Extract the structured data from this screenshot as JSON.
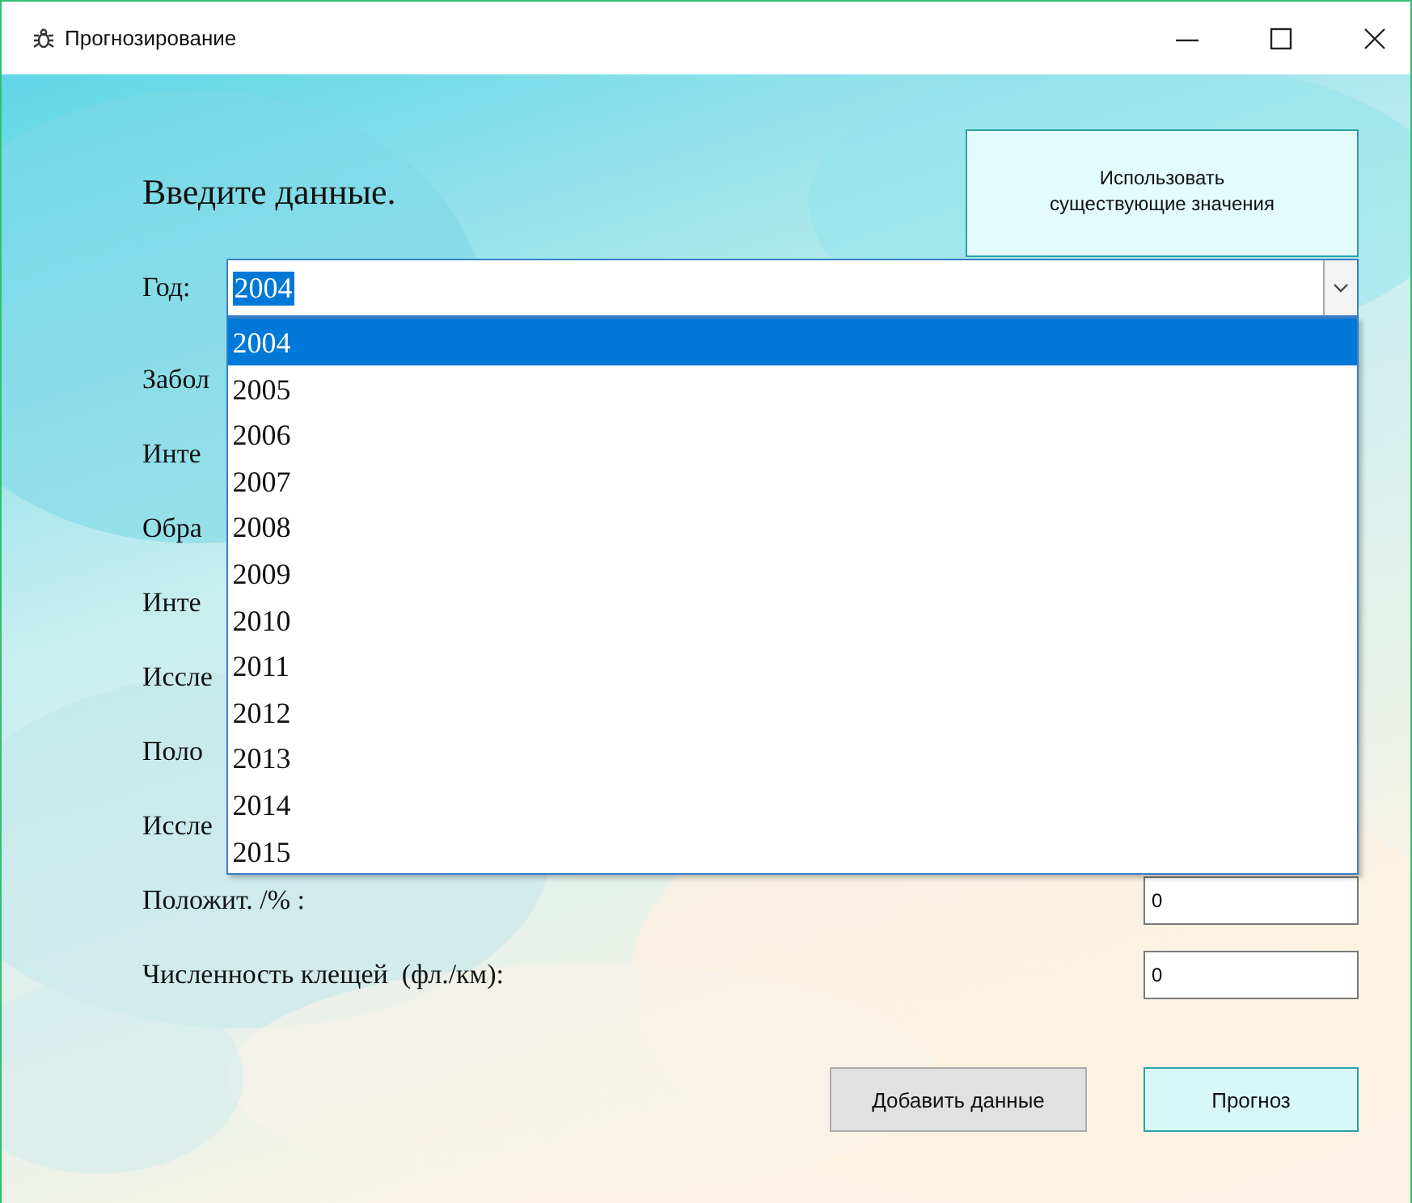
{
  "window": {
    "title": "Прогнозирование"
  },
  "heading": "Введите данные.",
  "use_existing_button": "Использовать существующие значения",
  "year": {
    "label": "Год:",
    "value": "2004",
    "text_selected": true,
    "expanded": true,
    "options": [
      {
        "label": "2004",
        "selected": true
      },
      {
        "label": "2005",
        "selected": false
      },
      {
        "label": "2006",
        "selected": false
      },
      {
        "label": "2007",
        "selected": false
      },
      {
        "label": "2008",
        "selected": false
      },
      {
        "label": "2009",
        "selected": false
      },
      {
        "label": "2010",
        "selected": false
      },
      {
        "label": "2011",
        "selected": false
      },
      {
        "label": "2012",
        "selected": false
      },
      {
        "label": "2013",
        "selected": false
      },
      {
        "label": "2014",
        "selected": false
      },
      {
        "label": "2015",
        "selected": false
      }
    ]
  },
  "fields": [
    {
      "label": "Забол"
    },
    {
      "label": "Инте"
    },
    {
      "label": "Обра"
    },
    {
      "label": "Инте"
    },
    {
      "label": "Иссле"
    },
    {
      "label": "Поло"
    },
    {
      "label": "Иссле"
    },
    {
      "label": "Положит. /% :",
      "value": "0"
    },
    {
      "label": "Численность клещей  (фл./км):",
      "value": "0"
    }
  ],
  "buttons": [
    {
      "label": "Добавить данные",
      "kind": "plain"
    },
    {
      "label": "Прогноз",
      "kind": "accent"
    }
  ]
}
